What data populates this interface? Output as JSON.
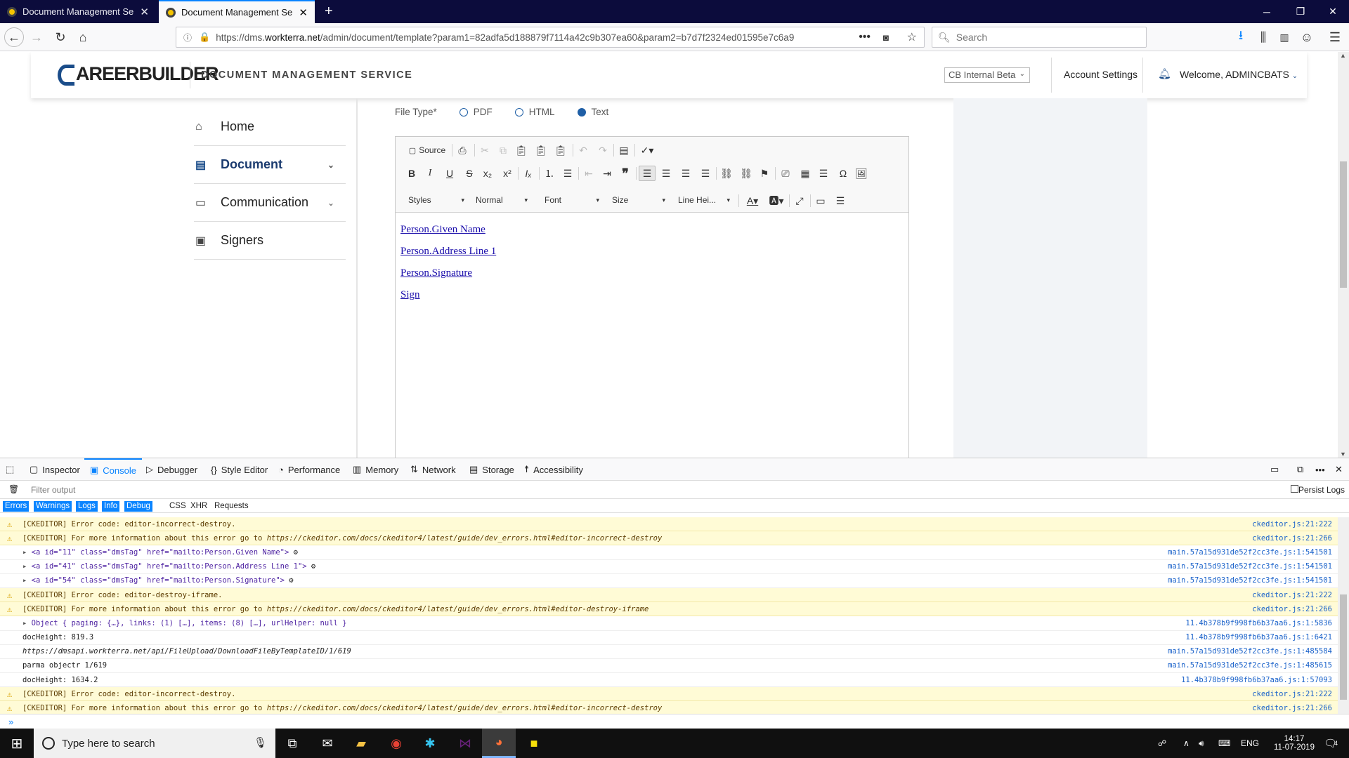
{
  "browser": {
    "tabs": [
      {
        "title": "Document Management Servic",
        "active": false
      },
      {
        "title": "Document Management Servic",
        "active": true
      }
    ],
    "url_prefix": "https://dms.",
    "url_domain": "workterra.net",
    "url_rest": "/admin/document/template?param1=82adfa5d188879f7114a42c9b307ea60&param2=b7d7f2324ed01595e7c6a9",
    "search_placeholder": "Search"
  },
  "header": {
    "logo_text": "AREERBUILDER",
    "service_title": "DOCUMENT MANAGEMENT SERVICE",
    "env_select": "CB Internal Beta",
    "account_settings": "Account Settings",
    "welcome": "Welcome, ADMINCBATS"
  },
  "sidebar": {
    "items": [
      {
        "label": "Home",
        "icon": "home-icon"
      },
      {
        "label": "Document",
        "icon": "document-icon"
      },
      {
        "label": "Communication",
        "icon": "chat-icon"
      },
      {
        "label": "Signers",
        "icon": "id-badge-icon"
      }
    ]
  },
  "form": {
    "file_type_label": "File Type*",
    "options": [
      "PDF",
      "HTML",
      "Text"
    ],
    "selected": "Text"
  },
  "editor": {
    "source_label": "Source",
    "combos": [
      "Styles",
      "Normal",
      "Font",
      "Size",
      "Line Hei..."
    ],
    "content": [
      "Person.Given Name",
      "Person.Address Line 1",
      "Person.Signature",
      "Sign"
    ]
  },
  "devtools": {
    "tabs": [
      "Inspector",
      "Console",
      "Debugger",
      "Style Editor",
      "Performance",
      "Memory",
      "Network",
      "Storage",
      "Accessibility"
    ],
    "active_tab": "Console",
    "filter_placeholder": "Filter output",
    "persist_logs": "Persist Logs",
    "categories": [
      "Errors",
      "Warnings",
      "Logs",
      "Info",
      "Debug",
      "CSS",
      "XHR",
      "Requests"
    ],
    "logs": [
      {
        "type": "warn",
        "msg": "[CKEDITOR] Error code: editor-incorrect-destroy.",
        "src": "ckeditor.js:21:222"
      },
      {
        "type": "warn",
        "msg": "[CKEDITOR] For more information about this error go to ",
        "link": "https://ckeditor.com/docs/ckeditor4/latest/guide/dev_errors.html#editor-incorrect-destroy",
        "src": "ckeditor.js:21:266"
      },
      {
        "type": "obj",
        "msg": "<a id=\"11\" class=\"dmsTag\" href=\"mailto:Person.Given Name\">",
        "src": "main.57a15d931de52f2cc3fe.js:1:541501"
      },
      {
        "type": "obj",
        "msg": "<a id=\"41\" class=\"dmsTag\" href=\"mailto:Person.Address Line 1\">",
        "src": "main.57a15d931de52f2cc3fe.js:1:541501"
      },
      {
        "type": "obj",
        "msg": "<a id=\"54\" class=\"dmsTag\" href=\"mailto:Person.Signature\">",
        "src": "main.57a15d931de52f2cc3fe.js:1:541501"
      },
      {
        "type": "warn",
        "msg": "[CKEDITOR] Error code: editor-destroy-iframe.",
        "src": "ckeditor.js:21:222"
      },
      {
        "type": "warn",
        "msg": "[CKEDITOR] For more information about this error go to ",
        "link": "https://ckeditor.com/docs/ckeditor4/latest/guide/dev_errors.html#editor-destroy-iframe",
        "src": "ckeditor.js:21:266"
      },
      {
        "type": "obj",
        "msg": "Object { paging: {…}, links: (1) […], items: (8) […], urlHelper: null }",
        "src": "11.4b378b9f998fb6b37aa6.js:1:5836"
      },
      {
        "type": "log",
        "msg": "docHeight: 819.3",
        "src": "11.4b378b9f998fb6b37aa6.js:1:6421"
      },
      {
        "type": "log",
        "msg": "https://dmsapi.workterra.net/api/FileUpload/DownloadFileByTemplateID/1/619",
        "src": "main.57a15d931de52f2cc3fe.js:1:485584"
      },
      {
        "type": "log",
        "msg": "parma objectr 1/619",
        "src": "main.57a15d931de52f2cc3fe.js:1:485615"
      },
      {
        "type": "log",
        "msg": "docHeight: 1634.2",
        "src": "11.4b378b9f998fb6b37aa6.js:1:57093"
      },
      {
        "type": "warn",
        "msg": "[CKEDITOR] Error code: editor-incorrect-destroy.",
        "src": "ckeditor.js:21:222"
      },
      {
        "type": "warn",
        "msg": "[CKEDITOR] For more information about this error go to ",
        "link": "https://ckeditor.com/docs/ckeditor4/latest/guide/dev_errors.html#editor-incorrect-destroy",
        "src": "ckeditor.js:21:266"
      }
    ]
  },
  "taskbar": {
    "search_placeholder": "Type here to search",
    "lang": "ENG",
    "time": "14:17",
    "date": "11-07-2019",
    "notif_count": "4"
  }
}
